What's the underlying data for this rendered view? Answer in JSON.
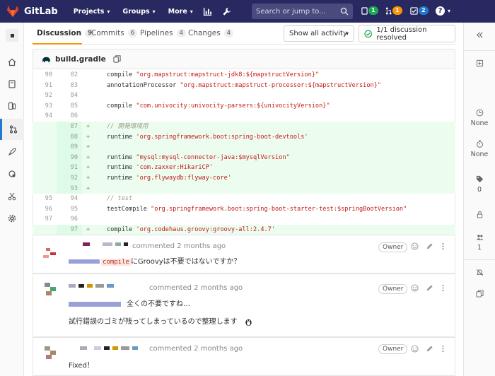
{
  "navbar": {
    "brand": "GitLab",
    "projects": "Projects",
    "groups": "Groups",
    "more": "More",
    "search_placeholder": "Search or jump to...",
    "issues_count": "1",
    "mr_count": "1",
    "todos_count": "2",
    "help_glyph": "?"
  },
  "tabs": [
    {
      "label": "Discussion",
      "count": "9"
    },
    {
      "label": "Commits",
      "count": "6"
    },
    {
      "label": "Pipelines",
      "count": "4"
    },
    {
      "label": "Changes",
      "count": "4"
    }
  ],
  "activity_filter": "Show all activity",
  "resolved_status": "1/1 discussion resolved",
  "file": {
    "name": "build.gradle"
  },
  "diff_lines": [
    {
      "old": "90",
      "new": "82",
      "sign": "",
      "added": false
    },
    {
      "old": "91",
      "new": "83",
      "sign": "",
      "added": false
    },
    {
      "old": "92",
      "new": "84",
      "sign": "",
      "added": false
    },
    {
      "old": "93",
      "new": "85",
      "sign": "",
      "added": false
    },
    {
      "old": "94",
      "new": "86",
      "sign": "",
      "added": false
    },
    {
      "old": "",
      "new": "87",
      "sign": "+",
      "added": true
    },
    {
      "old": "",
      "new": "88",
      "sign": "+",
      "added": true
    },
    {
      "old": "",
      "new": "89",
      "sign": "+",
      "added": true
    },
    {
      "old": "",
      "new": "90",
      "sign": "+",
      "added": true
    },
    {
      "old": "",
      "new": "91",
      "sign": "+",
      "added": true
    },
    {
      "old": "",
      "new": "92",
      "sign": "+",
      "added": true
    },
    {
      "old": "",
      "new": "93",
      "sign": "+",
      "added": true
    },
    {
      "old": "95",
      "new": "94",
      "sign": "",
      "added": false
    },
    {
      "old": "96",
      "new": "95",
      "sign": "",
      "added": false
    },
    {
      "old": "97",
      "new": "96",
      "sign": "",
      "added": false
    },
    {
      "old": "",
      "new": "97",
      "sign": "+",
      "added": true
    }
  ],
  "diff_code": {
    "l0_kw": "compile ",
    "l0_str": "\"org.mapstruct:mapstruct-jdk8:${mapstructVersion}\"",
    "l1_kw": "annotationProcessor ",
    "l1_str": "\"org.mapstruct:mapstruct-processor:${mapstructVersion}\"",
    "l3_kw": "compile ",
    "l3_str": "\"com.univocity:univocity-parsers:${univocityVersion}\"",
    "l5_cmt": "// 開発環境用",
    "l6_kw": "runtime ",
    "l6_str": "'org.springframework.boot:spring-boot-devtools'",
    "l8_kw": "runtime ",
    "l8_str": "\"mysql:mysql-connector-java:$mysqlVersion\"",
    "l9_kw": "runtime ",
    "l9_str": "'com.zaxxer:HikariCP'",
    "l10_kw": "runtime ",
    "l10_str": "'org.flywaydb:flyway-core'",
    "l12_cmt": "// test",
    "l13_kw": "testCompile ",
    "l13_str": "\"org.springframework.boot:spring-boot-starter-test:$springBootVersion\"",
    "l15_kw": "compile ",
    "l15_str": "'org.codehaus.groovy:groovy-all:2.4.7'"
  },
  "notes": [
    {
      "meta": "commented 2 months ago",
      "role": "Owner",
      "code": "compile",
      "body": "にGroovyは不要ではないですか？"
    },
    {
      "meta": "commented 2 months ago",
      "role": "Owner",
      "body1": "全くの不要ですね…",
      "body2": "試行錯誤のゴミが残ってしまっているので整理します"
    },
    {
      "meta": "commented 2 months ago",
      "role": "Owner",
      "body": "Fixed！"
    }
  ],
  "right_sidebar": {
    "time_estimate": "None",
    "time_spent": "None",
    "labels_count": "0",
    "participants_count": "1"
  },
  "colors": {
    "navbar": "#292961",
    "accent": "#fc9403",
    "added_bg": "#ecfdf0",
    "success": "#1aaa55"
  }
}
